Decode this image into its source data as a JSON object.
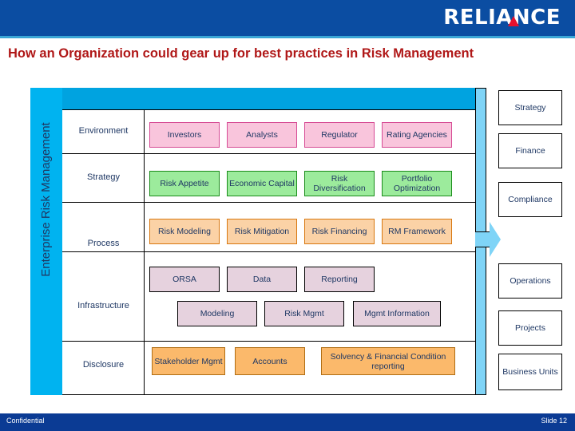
{
  "header": {
    "brand": "RELIANCE",
    "title": "How an Organization could gear up for best practices in Risk Management",
    "brand_color": "#ffffff",
    "band_color": "#0b4da2",
    "title_color": "#b01818"
  },
  "diagram": {
    "vertical_label": "Enterprise Risk Management",
    "rows": [
      {
        "label": "Environment",
        "style": "pink",
        "boxes": [
          {
            "text": "Investors"
          },
          {
            "text": "Analysts"
          },
          {
            "text": "Regulator"
          },
          {
            "text": "Rating Agencies"
          }
        ]
      },
      {
        "label": "Strategy",
        "style": "green",
        "boxes": [
          {
            "text": "Risk Appetite"
          },
          {
            "text": "Economic Capital"
          },
          {
            "text": "Risk Diversification"
          },
          {
            "text": "Portfolio Optimization"
          }
        ]
      },
      {
        "label": "Process",
        "style": "orange1",
        "boxes": [
          {
            "text": "Risk Modeling"
          },
          {
            "text": "Risk Mitigation"
          },
          {
            "text": "Risk Financing"
          },
          {
            "text": "RM Framework"
          }
        ]
      },
      {
        "label": "Infrastructure",
        "style": "purple",
        "boxes": [
          {
            "text": "ORSA"
          },
          {
            "text": "Data"
          },
          {
            "text": "Reporting"
          },
          {
            "text": "Modeling"
          },
          {
            "text": "Risk Mgmt"
          },
          {
            "text": "Mgmt Information"
          }
        ]
      },
      {
        "label": "Disclosure",
        "style": "orange2",
        "boxes": [
          {
            "text": "Stakeholder Mgmt"
          },
          {
            "text": "Accounts"
          },
          {
            "text": "Solvency & Financial Condition reporting"
          }
        ]
      }
    ],
    "side_boxes": [
      {
        "text": "Strategy"
      },
      {
        "text": "Finance"
      },
      {
        "text": "Compliance"
      },
      {
        "text": "Operations"
      },
      {
        "text": "Projects"
      },
      {
        "text": "Business Units"
      }
    ],
    "colors": {
      "left_bar": "#00b3f0",
      "top_band": "#00a3e0",
      "right_bar": "#7fd4f7",
      "text": "#1f3864"
    }
  },
  "footer": {
    "left": "Confidential",
    "right": "Slide  12",
    "color": "#0b3b94"
  }
}
